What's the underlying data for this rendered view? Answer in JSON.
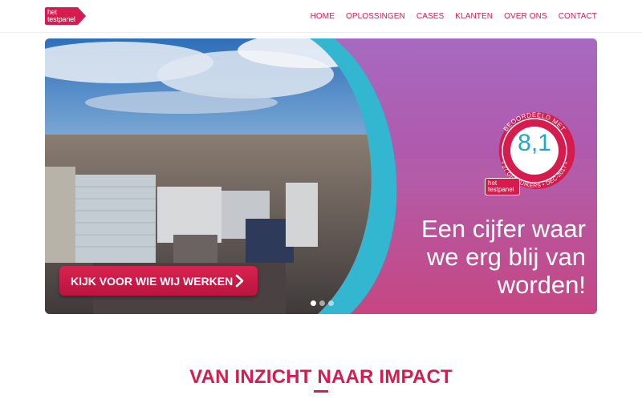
{
  "logo": {
    "line1": "het",
    "line2": "testpanel"
  },
  "nav": {
    "items": [
      "HOME",
      "OPLOSSINGEN",
      "CASES",
      "KLANTEN",
      "OVER ONS",
      "CONTACT"
    ]
  },
  "hero": {
    "cta_label": "KIJK VOOR WIE WIJ WERKEN",
    "headline": [
      "Een cijfer waar",
      "we erg blij van",
      "worden!"
    ],
    "badge": {
      "score": "8,1",
      "ring_top": "BEOORDEELD MET",
      "ring_bottom": "• 27 GEBRUIKERS • DEC-2017 •",
      "logo_line1": "het",
      "logo_line2": "testpanel"
    },
    "slides": {
      "count": 3,
      "active": 0
    }
  },
  "section": {
    "title": "VAN INZICHT NAAR IMPACT"
  },
  "colors": {
    "brand": "#d61c4e",
    "accent": "#1fa8c9",
    "overlay": "#9a5fb0"
  }
}
